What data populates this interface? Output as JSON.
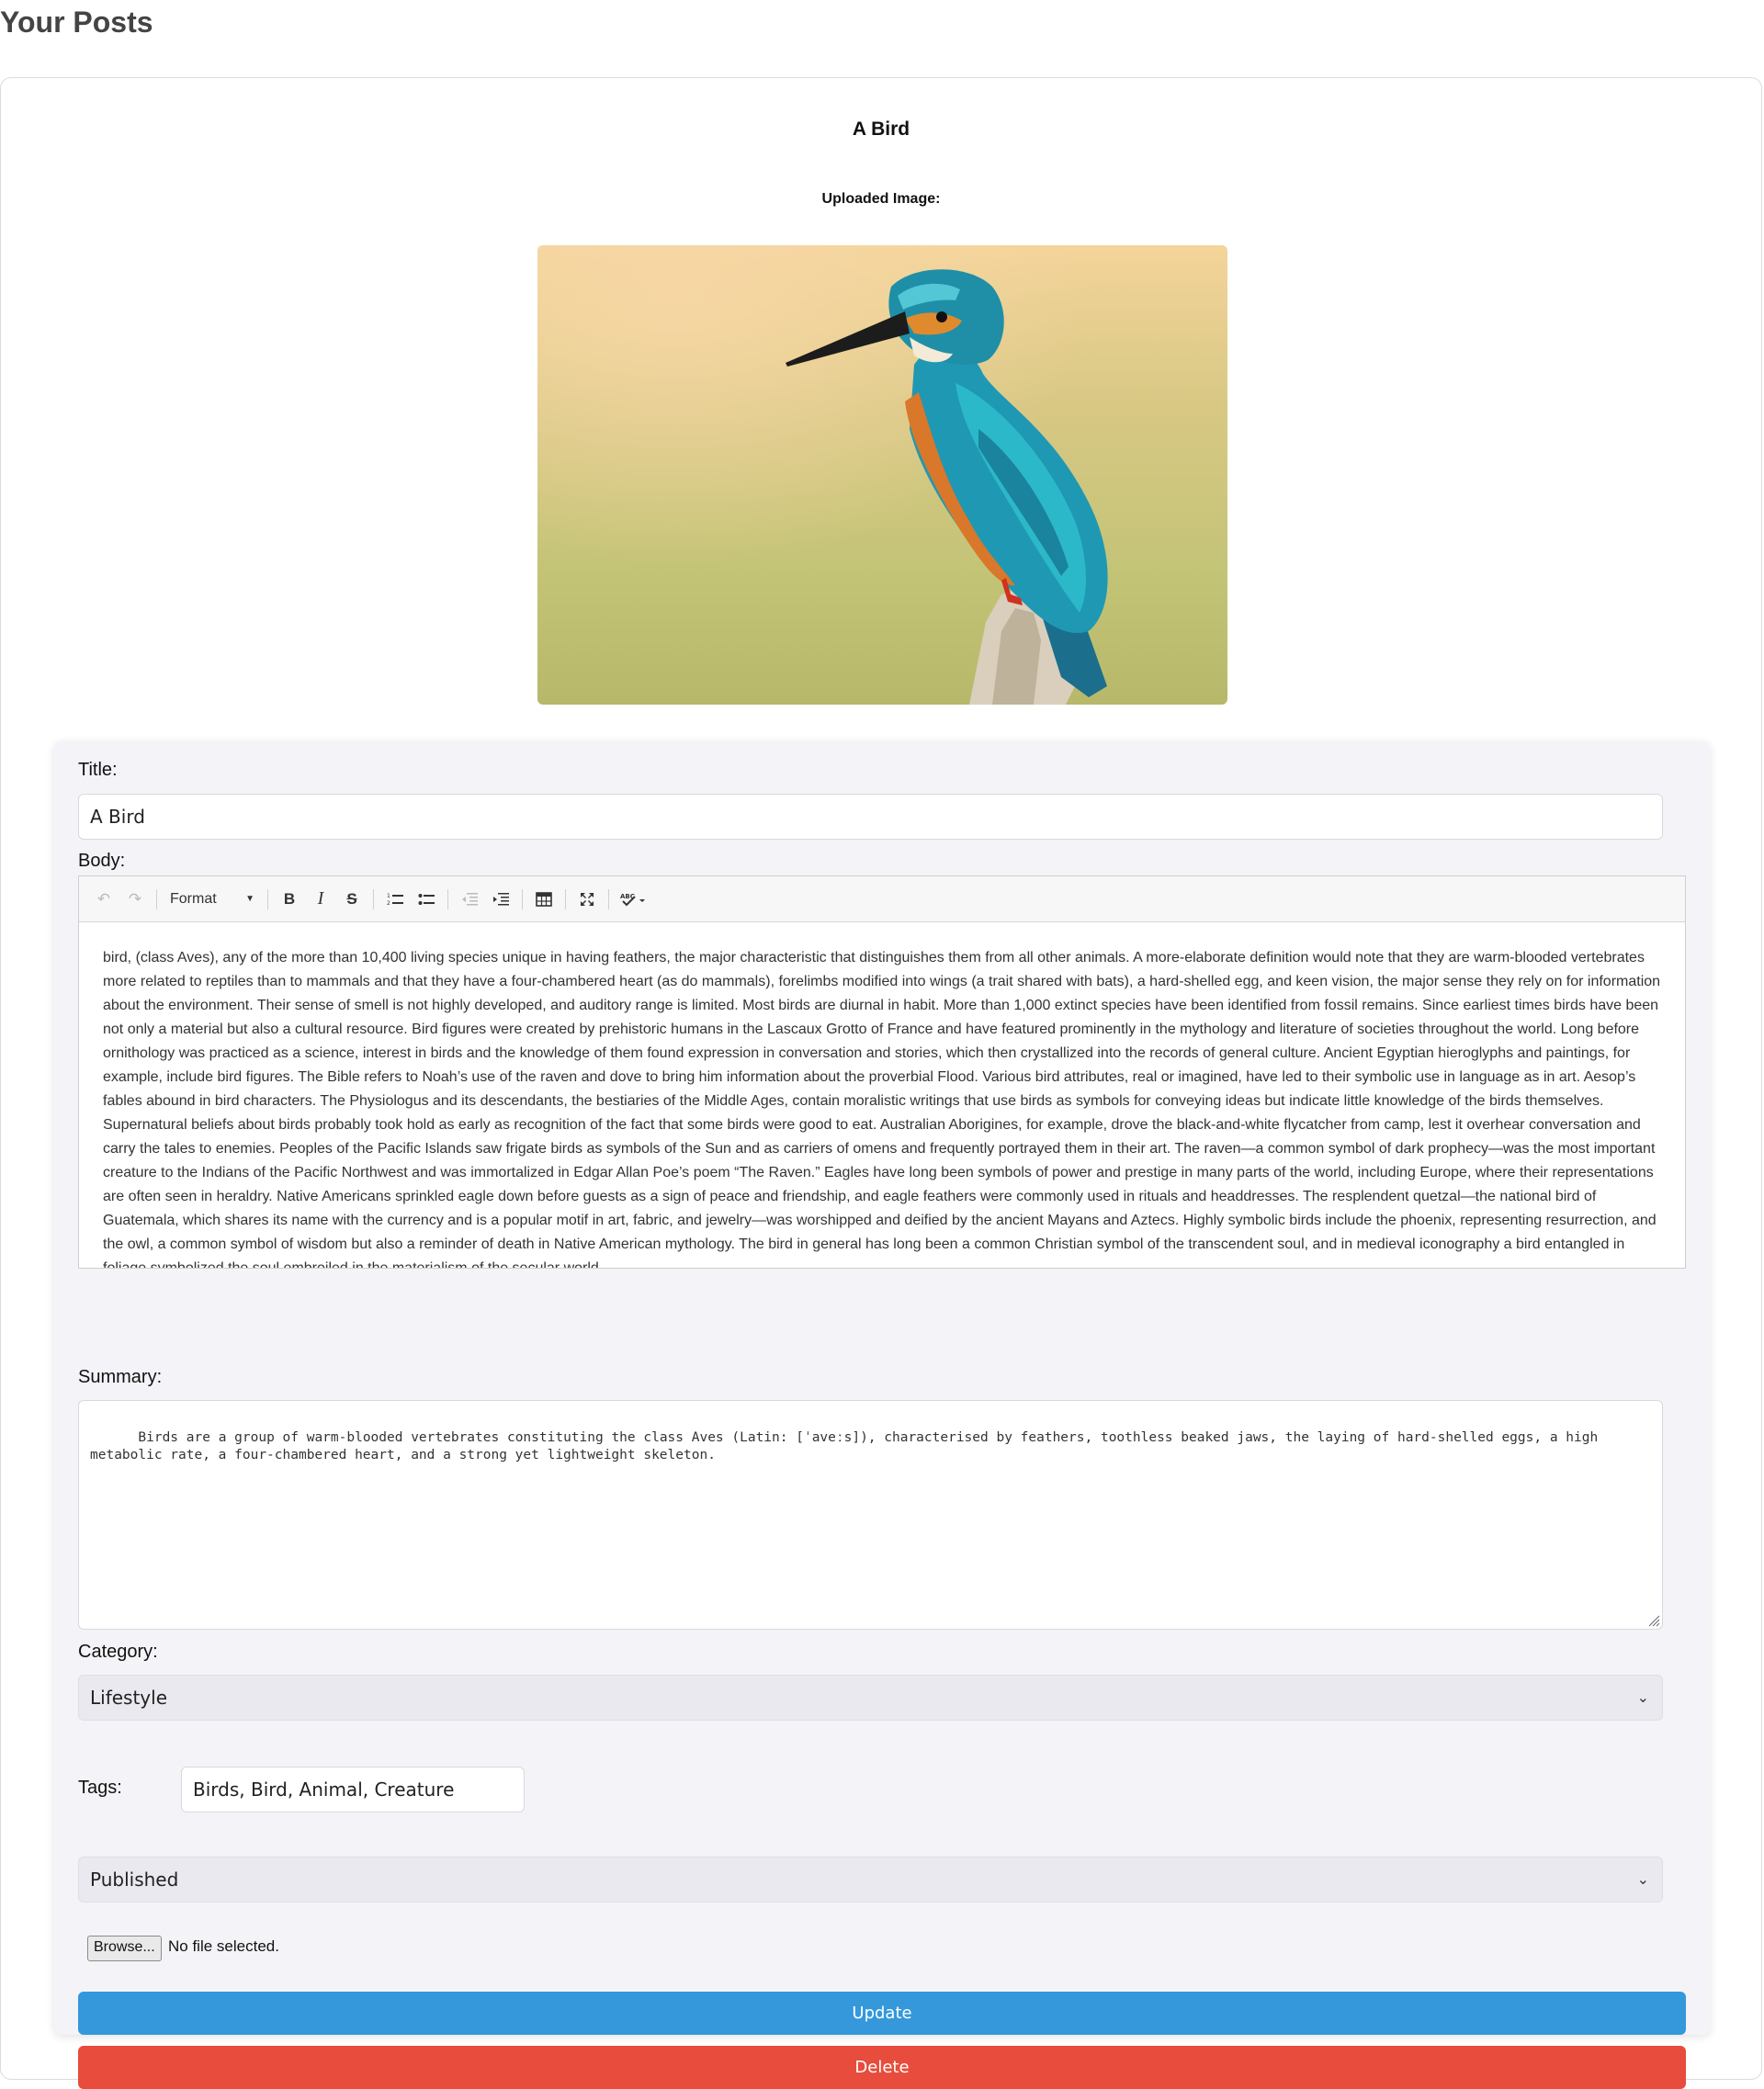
{
  "page": {
    "heading": "Your Posts"
  },
  "post": {
    "title": "A Bird",
    "uploaded_label": "Uploaded Image:"
  },
  "form": {
    "title_label": "Title:",
    "title_value": "A Bird",
    "body_label": "Body:",
    "toolbar": {
      "format_label": "Format",
      "icons": [
        "undo-icon",
        "redo-icon",
        "format-dropdown",
        "bold-icon",
        "italic-icon",
        "strikethrough-icon",
        "numbered-list-icon",
        "bullet-list-icon",
        "outdent-icon",
        "indent-icon",
        "table-icon",
        "fullscreen-icon",
        "spellcheck-icon"
      ]
    },
    "body_text": "bird, (class Aves), any of the more than 10,400 living species unique in having feathers, the major characteristic that distinguishes them from all other animals. A more-elaborate definition would note that they are warm-blooded vertebrates more related to reptiles than to mammals and that they have a four-chambered heart (as do mammals), forelimbs modified into wings (a trait shared with bats), a hard-shelled egg, and keen vision, the major sense they rely on for information about the environment. Their sense of smell is not highly developed, and auditory range is limited. Most birds are diurnal in habit. More than 1,000 extinct species have been identified from fossil remains. Since earliest times birds have been not only a material but also a cultural resource. Bird figures were created by prehistoric humans in the Lascaux Grotto of France and have featured prominently in the mythology and literature of societies throughout the world. Long before ornithology was practiced as a science, interest in birds and the knowledge of them found expression in conversation and stories, which then crystallized into the records of general culture. Ancient Egyptian hieroglyphs and paintings, for example, include bird figures. The Bible refers to Noah’s use of the raven and dove to bring him information about the proverbial Flood. Various bird attributes, real or imagined, have led to their symbolic use in language as in art. Aesop’s fables abound in bird characters. The Physiologus and its descendants, the bestiaries of the Middle Ages, contain moralistic writings that use birds as symbols for conveying ideas but indicate little knowledge of the birds themselves. Supernatural beliefs about birds probably took hold as early as recognition of the fact that some birds were good to eat. Australian Aborigines, for example, drove the black-and-white flycatcher from camp, lest it overhear conversation and carry the tales to enemies. Peoples of the Pacific Islands saw frigate birds as symbols of the Sun and as carriers of omens and frequently portrayed them in their art. The raven—a common symbol of dark prophecy—was the most important creature to the Indians of the Pacific Northwest and was immortalized in Edgar Allan Poe’s poem “The Raven.” Eagles have long been symbols of power and prestige in many parts of the world, including Europe, where their representations are often seen in heraldry. Native Americans sprinkled eagle down before guests as a sign of peace and friendship, and eagle feathers were commonly used in rituals and headdresses. The resplendent quetzal—the national bird of Guatemala, which shares its name with the currency and is a popular motif in art, fabric, and jewelry—was worshipped and deified by the ancient Mayans and Aztecs. Highly symbolic birds include the phoenix, representing resurrection, and the owl, a common symbol of wisdom but also a reminder of death in Native American mythology. The bird in general has long been a common Christian symbol of the transcendent soul, and in medieval iconography a bird entangled in foliage symbolized the soul embroiled in the materialism of the secular world.",
    "summary_label": "Summary:",
    "summary_value": "Birds are a group of warm-blooded vertebrates constituting the class Aves (Latin: [ˈaveːs]), characterised by feathers, toothless beaked jaws, the laying of hard-shelled eggs, a high metabolic rate, a four-chambered heart, and a strong yet lightweight skeleton.",
    "category_label": "Category:",
    "category_value": "Lifestyle",
    "tags_label": "Tags:",
    "tags_value": "Birds, Bird, Animal, Creature",
    "status_value": "Published",
    "browse_label": "Browse...",
    "file_status": "No file selected.",
    "update_label": "Update",
    "delete_label": "Delete"
  },
  "colors": {
    "update_button": "#3498db",
    "delete_button": "#e74c3c",
    "form_background": "#f4f4f8"
  }
}
